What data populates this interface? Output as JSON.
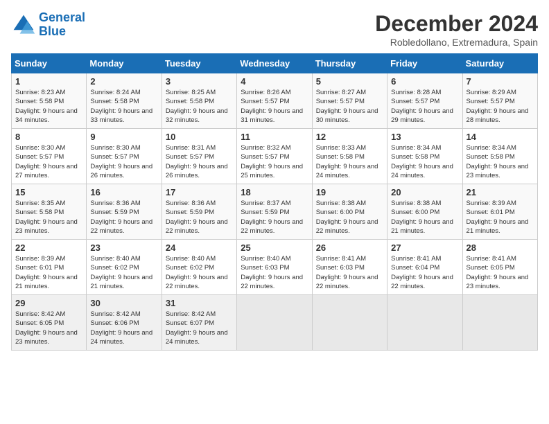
{
  "logo": {
    "text_general": "General",
    "text_blue": "Blue"
  },
  "header": {
    "month": "December 2024",
    "location": "Robledollano, Extremadura, Spain"
  },
  "weekdays": [
    "Sunday",
    "Monday",
    "Tuesday",
    "Wednesday",
    "Thursday",
    "Friday",
    "Saturday"
  ],
  "weeks": [
    [
      {
        "day": "1",
        "sunrise": "8:23 AM",
        "sunset": "5:58 PM",
        "daylight": "9 hours and 34 minutes."
      },
      {
        "day": "2",
        "sunrise": "8:24 AM",
        "sunset": "5:58 PM",
        "daylight": "9 hours and 33 minutes."
      },
      {
        "day": "3",
        "sunrise": "8:25 AM",
        "sunset": "5:58 PM",
        "daylight": "9 hours and 32 minutes."
      },
      {
        "day": "4",
        "sunrise": "8:26 AM",
        "sunset": "5:57 PM",
        "daylight": "9 hours and 31 minutes."
      },
      {
        "day": "5",
        "sunrise": "8:27 AM",
        "sunset": "5:57 PM",
        "daylight": "9 hours and 30 minutes."
      },
      {
        "day": "6",
        "sunrise": "8:28 AM",
        "sunset": "5:57 PM",
        "daylight": "9 hours and 29 minutes."
      },
      {
        "day": "7",
        "sunrise": "8:29 AM",
        "sunset": "5:57 PM",
        "daylight": "9 hours and 28 minutes."
      }
    ],
    [
      {
        "day": "8",
        "sunrise": "8:30 AM",
        "sunset": "5:57 PM",
        "daylight": "9 hours and 27 minutes."
      },
      {
        "day": "9",
        "sunrise": "8:30 AM",
        "sunset": "5:57 PM",
        "daylight": "9 hours and 26 minutes."
      },
      {
        "day": "10",
        "sunrise": "8:31 AM",
        "sunset": "5:57 PM",
        "daylight": "9 hours and 26 minutes."
      },
      {
        "day": "11",
        "sunrise": "8:32 AM",
        "sunset": "5:57 PM",
        "daylight": "9 hours and 25 minutes."
      },
      {
        "day": "12",
        "sunrise": "8:33 AM",
        "sunset": "5:58 PM",
        "daylight": "9 hours and 24 minutes."
      },
      {
        "day": "13",
        "sunrise": "8:34 AM",
        "sunset": "5:58 PM",
        "daylight": "9 hours and 24 minutes."
      },
      {
        "day": "14",
        "sunrise": "8:34 AM",
        "sunset": "5:58 PM",
        "daylight": "9 hours and 23 minutes."
      }
    ],
    [
      {
        "day": "15",
        "sunrise": "8:35 AM",
        "sunset": "5:58 PM",
        "daylight": "9 hours and 23 minutes."
      },
      {
        "day": "16",
        "sunrise": "8:36 AM",
        "sunset": "5:59 PM",
        "daylight": "9 hours and 22 minutes."
      },
      {
        "day": "17",
        "sunrise": "8:36 AM",
        "sunset": "5:59 PM",
        "daylight": "9 hours and 22 minutes."
      },
      {
        "day": "18",
        "sunrise": "8:37 AM",
        "sunset": "5:59 PM",
        "daylight": "9 hours and 22 minutes."
      },
      {
        "day": "19",
        "sunrise": "8:38 AM",
        "sunset": "6:00 PM",
        "daylight": "9 hours and 22 minutes."
      },
      {
        "day": "20",
        "sunrise": "8:38 AM",
        "sunset": "6:00 PM",
        "daylight": "9 hours and 21 minutes."
      },
      {
        "day": "21",
        "sunrise": "8:39 AM",
        "sunset": "6:01 PM",
        "daylight": "9 hours and 21 minutes."
      }
    ],
    [
      {
        "day": "22",
        "sunrise": "8:39 AM",
        "sunset": "6:01 PM",
        "daylight": "9 hours and 21 minutes."
      },
      {
        "day": "23",
        "sunrise": "8:40 AM",
        "sunset": "6:02 PM",
        "daylight": "9 hours and 21 minutes."
      },
      {
        "day": "24",
        "sunrise": "8:40 AM",
        "sunset": "6:02 PM",
        "daylight": "9 hours and 22 minutes."
      },
      {
        "day": "25",
        "sunrise": "8:40 AM",
        "sunset": "6:03 PM",
        "daylight": "9 hours and 22 minutes."
      },
      {
        "day": "26",
        "sunrise": "8:41 AM",
        "sunset": "6:03 PM",
        "daylight": "9 hours and 22 minutes."
      },
      {
        "day": "27",
        "sunrise": "8:41 AM",
        "sunset": "6:04 PM",
        "daylight": "9 hours and 22 minutes."
      },
      {
        "day": "28",
        "sunrise": "8:41 AM",
        "sunset": "6:05 PM",
        "daylight": "9 hours and 23 minutes."
      }
    ],
    [
      {
        "day": "29",
        "sunrise": "8:42 AM",
        "sunset": "6:05 PM",
        "daylight": "9 hours and 23 minutes."
      },
      {
        "day": "30",
        "sunrise": "8:42 AM",
        "sunset": "6:06 PM",
        "daylight": "9 hours and 24 minutes."
      },
      {
        "day": "31",
        "sunrise": "8:42 AM",
        "sunset": "6:07 PM",
        "daylight": "9 hours and 24 minutes."
      },
      null,
      null,
      null,
      null
    ]
  ]
}
